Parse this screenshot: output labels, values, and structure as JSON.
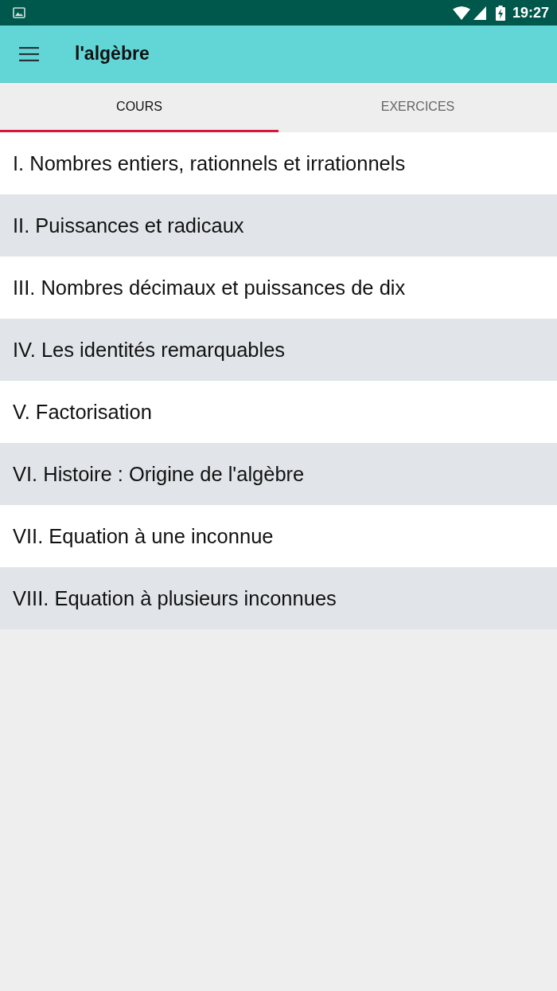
{
  "status_bar": {
    "time": "19:27"
  },
  "app_bar": {
    "title": "l'algèbre"
  },
  "tabs": [
    {
      "label": "COURS",
      "selected": true
    },
    {
      "label": "EXERCICES",
      "selected": false
    }
  ],
  "chapters": [
    "I. Nombres entiers, rationnels et irrationnels",
    "II. Puissances et radicaux",
    "III. Nombres décimaux et puissances de dix",
    "IV. Les identités remarquables",
    "V. Factorisation",
    "VI. Histoire : Origine de l'algèbre",
    "VII. Equation à une inconnue",
    "VIII. Equation à plusieurs inconnues"
  ]
}
